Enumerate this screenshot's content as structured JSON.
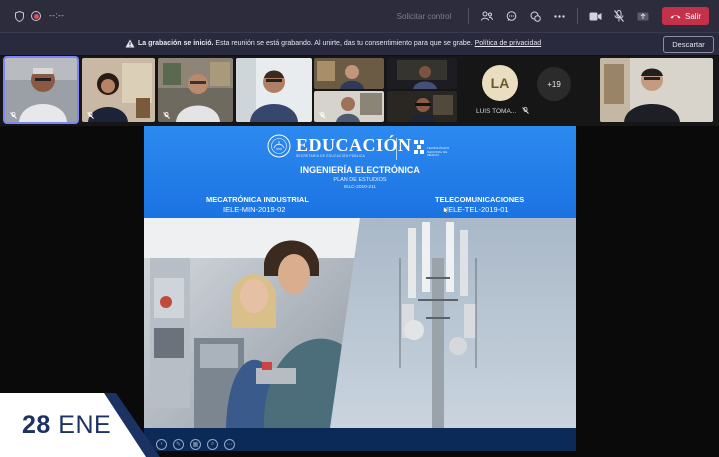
{
  "topbar": {
    "timer": "--:--",
    "request_control": "Solicitar control",
    "leave_label": "Salir",
    "icons": [
      "shield-icon",
      "record-icon",
      "people-icon",
      "chat-icon",
      "reactions-icon",
      "more-icon",
      "camera-icon",
      "mic-off-icon",
      "share-icon",
      "phone-icon"
    ]
  },
  "banner": {
    "bold": "La grabación se inició.",
    "text": "Esta reunión se está grabando. Al unirte, das tu consentimiento para que se grabe.",
    "link": "Política de privacidad",
    "dismiss": "Descartar"
  },
  "participants": {
    "initials": "LA",
    "name": "LUIS TOMA...",
    "overflow": "+19"
  },
  "slide": {
    "brand": "EDUCACIÓN",
    "brand_sub": "SECRETARÍA DE EDUCACIÓN PÚBLICA",
    "tec_sub": "TECNOLÓGICO NACIONAL DE MÉXICO",
    "program": "INGENIERÍA ELECTRÓNICA",
    "plan": "PLAN DE ESTUDIOS",
    "plan_code": "IELC-2010-211",
    "left_title": "MECATRÓNICA INDUSTRIAL",
    "left_code": "IELE-MIN-2019-02",
    "right_title": "TELECOMUNICACIONES",
    "right_code": "IELE-TEL-2019-01"
  },
  "badge": {
    "day": "28",
    "month": "ENE"
  },
  "colors": {
    "teams_bar": "#2d2c3c",
    "leave": "#c4314b",
    "slide_blue": "#1b73e2",
    "badge_navy": "#1b3263"
  }
}
